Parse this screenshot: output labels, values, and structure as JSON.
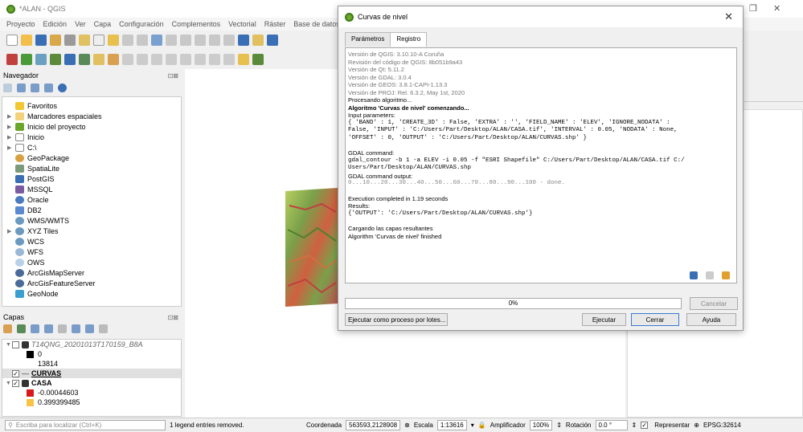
{
  "window": {
    "title": "*ALAN - QGIS"
  },
  "menu": [
    "Proyecto",
    "Edición",
    "Ver",
    "Capa",
    "Configuración",
    "Complementos",
    "Vectorial",
    "Ráster",
    "Base de datos"
  ],
  "navigator": {
    "title": "Navegador",
    "items": [
      {
        "label": "Favoritos",
        "icon": "star-icon"
      },
      {
        "label": "Marcadores espaciales",
        "icon": "folder-icon"
      },
      {
        "label": "Inicio del proyecto",
        "icon": "folder-icon"
      },
      {
        "label": "Inicio",
        "icon": "folder-icon"
      },
      {
        "label": "C:\\",
        "icon": "folder-icon"
      },
      {
        "label": "GeoPackage",
        "icon": "geopackage-icon"
      },
      {
        "label": "SpatiaLite",
        "icon": "feather-icon"
      },
      {
        "label": "PostGIS",
        "icon": "elephant-icon"
      },
      {
        "label": "MSSQL",
        "icon": "database-icon"
      },
      {
        "label": "Oracle",
        "icon": "database-icon"
      },
      {
        "label": "DB2",
        "icon": "database-icon"
      },
      {
        "label": "WMS/WMTS",
        "icon": "globe-icon"
      },
      {
        "label": "XYZ Tiles",
        "icon": "globe-icon"
      },
      {
        "label": "WCS",
        "icon": "globe-icon"
      },
      {
        "label": "WFS",
        "icon": "globe-icon"
      },
      {
        "label": "OWS",
        "icon": "globe-icon"
      },
      {
        "label": "ArcGisMapServer",
        "icon": "globe-icon"
      },
      {
        "label": "ArcGisFeatureServer",
        "icon": "globe-icon"
      },
      {
        "label": "GeoNode",
        "icon": "geonode-icon"
      }
    ]
  },
  "layers": {
    "title": "Capas",
    "raster1": "T14QNG_20201013T170159_B8A",
    "raster1_min": "0",
    "raster1_max": "13814",
    "curvas": "CURVAS",
    "casa": "CASA",
    "casa_min": "-0.00044603",
    "casa_max": "0.399399485"
  },
  "dialog": {
    "title": "Curvas de nivel",
    "tab_params": "Parámetros",
    "tab_log": "Registro",
    "log": {
      "l1": "Versión de QGIS: 3.10.10-A Coruña",
      "l2": "Revisión del código de QGIS: 8b051b9a43",
      "l3": "Versión de Qt: 5.11.2",
      "l4": "Versión de GDAL: 3.0.4",
      "l5": "Versión de GEOS: 3.8.1-CAPI-1.13.3",
      "l6": "Versión de PROJ: Rel. 6.3.2, May 1st, 2020",
      "l7": "Procesando algoritmo...",
      "l8": "Algoritmo 'Curvas de nivel' comenzando...",
      "l9": "Input parameters:",
      "l10": "{ 'BAND' : 1, 'CREATE_3D' : False, 'EXTRA' : '', 'FIELD_NAME' : 'ELEV', 'IGNORE_NODATA' :",
      "l11": "False, 'INPUT' : 'C:/Users/Part/Desktop/ALAN/CASA.tif', 'INTERVAL' : 0.05, 'NODATA' : None,",
      "l12": "'OFFSET' : 0, 'OUTPUT' : 'C:/Users/Part/Desktop/ALAN/CURVAS.shp' }",
      "l13": "GDAL command:",
      "l14": "gdal_contour -b 1 -a ELEV -i 0.05 -f \"ESRI Shapefile\" C:/Users/Part/Desktop/ALAN/CASA.tif C:/",
      "l15": "Users/Part/Desktop/ALAN/CURVAS.shp",
      "l16": "GDAL command output:",
      "l17": "0...10...20...30...40...50...60...70...80...90...100 - done.",
      "l18": "Execution completed in 1.19 seconds",
      "l19": "Results:",
      "l20": "{'OUTPUT': 'C:/Users/Part/Desktop/ALAN/CURVAS.shp'}",
      "l21": "Cargando las capas resultantes",
      "l22": "Algorithm 'Curvas de nivel' finished"
    },
    "progress_text": "0%",
    "progress_value": 0,
    "cancel": "Cancelar",
    "batch": "Ejecutar como proceso por lotes...",
    "run": "Ejecutar",
    "close": "Cerrar",
    "help": "Ayuda"
  },
  "status": {
    "search_placeholder": "Escriba para localizar (Ctrl+K)",
    "message": "1 legend entries removed.",
    "coord_label": "Coordenada",
    "coord_value": "563593,2128908",
    "scale_label": "Escala",
    "scale_value": "1:13616",
    "magnifier_label": "Amplificador",
    "magnifier_value": "100%",
    "rotation_label": "Rotación",
    "rotation_value": "0.0 °",
    "render_label": "Representar",
    "crs": "EPSG:32614"
  }
}
